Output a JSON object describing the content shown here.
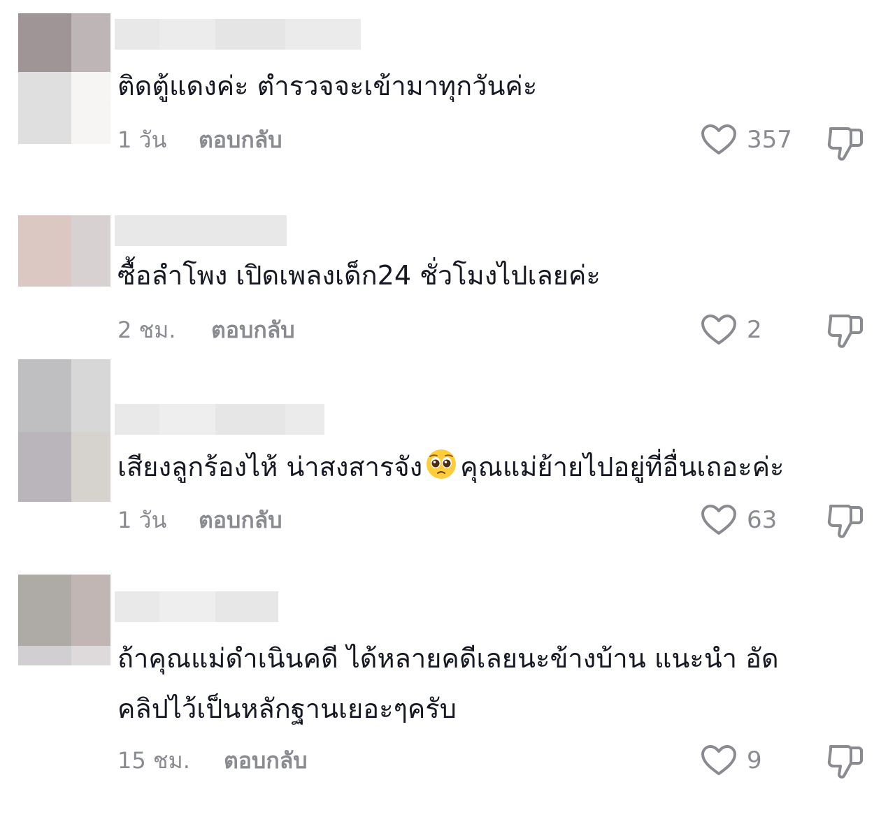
{
  "comments": [
    {
      "text": "ติดตู้แดงค่ะ ตำรวจจะเข้ามาทุกวันค่ะ",
      "time": "1 วัน",
      "reply_label": "ตอบกลับ",
      "likes": "357"
    },
    {
      "text": "ซื้อลำโพง เปิดเพลงเด็ก24 ชั่วโมงไปเลยค่ะ",
      "time": "2 ชม.",
      "reply_label": "ตอบกลับ",
      "likes": "2"
    },
    {
      "text_before_emoji": "เสียงลูกร้องไห้ น่าสงสารจัง",
      "text_after_emoji": "คุณแม่ย้ายไปอยู่ที่อื่นเถอะค่ะ",
      "emoji": "pleading-face-emoji",
      "time": "1 วัน",
      "reply_label": "ตอบกลับ",
      "likes": "63"
    },
    {
      "text_line1": "ถ้าคุณแม่ดำเนินคดี ได้หลายคดีเลยนะข้างบ้าน แนะนำ อัด",
      "text_line2": "คลิปไว้เป็นหลักฐานเยอะๆครับ",
      "time": "15 ชม.",
      "reply_label": "ตอบกลับ",
      "likes": "9"
    }
  ],
  "icons": {
    "like": "heart-outline-icon",
    "dislike": "thumbs-down-outline-icon"
  },
  "colors": {
    "text": "#161823",
    "muted": "#8a8b91"
  }
}
